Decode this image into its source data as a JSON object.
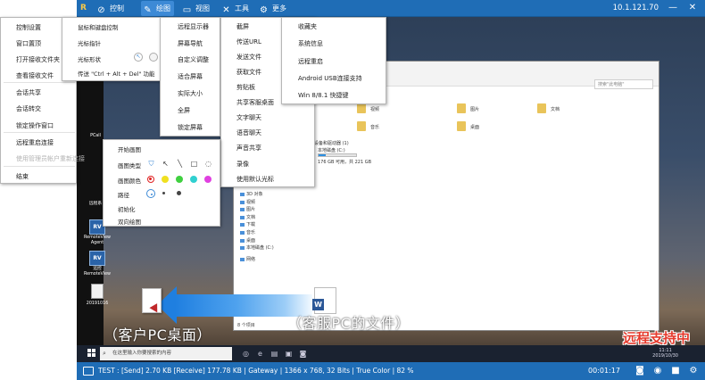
{
  "toolbar": {
    "logo": "R",
    "items": [
      {
        "label": "控制",
        "icon": "control-icon"
      },
      {
        "label": "绘图",
        "icon": "pencil-icon"
      },
      {
        "label": "视图",
        "icon": "monitor-icon"
      },
      {
        "label": "工具",
        "icon": "tools-icon"
      },
      {
        "label": "更多",
        "icon": "gear-icon"
      }
    ],
    "ip": "10.1.121.70"
  },
  "menus": {
    "control": [
      "控制设置",
      "窗口置顶",
      "打开接收文件夹",
      "查看接收文件",
      "会话共享",
      "会话转交",
      "锁定操作窗口",
      "远程重启连接",
      "使用管理员帐户重新连接",
      "结束"
    ],
    "mouse": [
      "鼠标和键盘控制",
      "光标指针",
      "光标形状",
      "传送 \"Ctrl + Alt + Del\" 功能"
    ],
    "view": [
      "远程显示器",
      "屏幕导航",
      "自定义调整",
      "适合屏幕",
      "实际大小",
      "全屏",
      "锁定屏幕"
    ],
    "tools": [
      "截屏",
      "传送URL",
      "发送文件",
      "获取文件",
      "剪贴板",
      "共享客服桌面",
      "文字聊天",
      "语音聊天",
      "声音共享",
      "录像",
      "使用默认光标"
    ],
    "more": [
      "收藏夹",
      "系统信息",
      "远程重启",
      "Android USB连接支持",
      "Win 8/8.1 快捷键"
    ],
    "draw": {
      "start": "开始画图",
      "type_label": "画图类型",
      "color_label": "画图颜色",
      "stroke_label": "路径",
      "init": "初始化",
      "bidirectional": "双向绘图",
      "colors": [
        "#e02020",
        "#f0e020",
        "#40d040",
        "#30d0d0",
        "#e040e0"
      ]
    }
  },
  "desktop_icons": [
    {
      "label": "RV",
      "text": "RemoteView Agent"
    },
    {
      "label": "RV",
      "text": "远控 RemoteView"
    }
  ],
  "desktop_labels": {
    "top": "PCall",
    "mid": "远程系",
    "file": "20191016"
  },
  "explorer": {
    "search_placeholder": "搜索\"此电脑\"",
    "folders": [
      "视频",
      "图片",
      "文档",
      "音乐",
      "桌面"
    ],
    "drives_header": "设备和驱动器 (1)",
    "drive_name": "本地磁盘 (C:)",
    "drive_info": "176 GB 可用，共 221 GB",
    "drive_fill": 0.2,
    "sidebar": [
      "3D 对象",
      "视频",
      "图片",
      "文档",
      "下载",
      "音乐",
      "桌面",
      "本地磁盘 (C:)",
      "网络"
    ],
    "status": "8 个项目"
  },
  "taskbar": {
    "search": "在这里输入你要搜索的内容",
    "time": "11:11",
    "date": "2019/10/30"
  },
  "overlay": {
    "client_caption": "（客户PC桌面）",
    "agent_caption": "（客服PC的文件）",
    "stamp": "远程支持中"
  },
  "statusbar": {
    "info": "TEST : [Send] 2.70 KB  [Receive] 177.78 KB  |  Gateway  |  1366 x 768, 32 Bits  |  True Color  |  82 %",
    "timer": "00:01:17"
  },
  "colors": {
    "toolbar": "#1f6db6",
    "accent": "#3d8ad6",
    "stamp": "#e53a2c"
  }
}
